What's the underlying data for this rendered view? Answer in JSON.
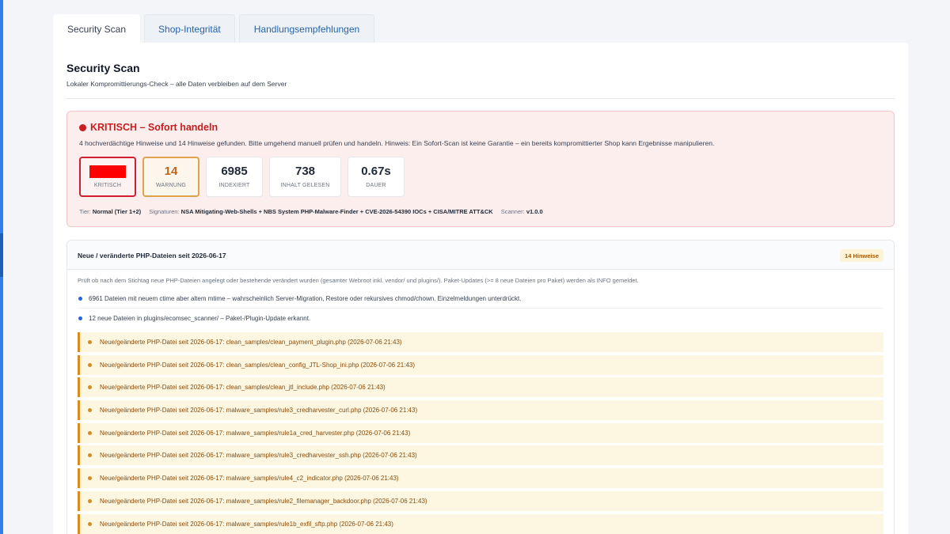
{
  "tabs": [
    {
      "label": "Security Scan",
      "active": true
    },
    {
      "label": "Shop-Integrität",
      "active": false
    },
    {
      "label": "Handlungsempfehlungen",
      "active": false
    }
  ],
  "page": {
    "title": "Security Scan",
    "subtitle": "Lokaler Kompromittierungs-Check – alle Daten verbleiben auf dem Server"
  },
  "alert": {
    "title": "KRITISCH – Sofort handeln",
    "text": "4 hochverdächtige Hinweise und 14 Hinweise gefunden. Bitte umgehend manuell prüfen und handeln. Hinweis: Ein Sofort-Scan ist keine Garantie – ein bereits kompromittierter Shop kann Ergebnisse manipulieren.",
    "color": "#c81e1e"
  },
  "stats": {
    "critical": {
      "value": "4",
      "label": "KRITISCH"
    },
    "warning": {
      "value": "14",
      "label": "WARNUNG"
    },
    "indexed": {
      "value": "6985",
      "label": "INDEXIERT"
    },
    "read": {
      "value": "738",
      "label": "INHALT GELESEN"
    },
    "duration": {
      "value": "0.67s",
      "label": "DAUER"
    }
  },
  "meta": {
    "tier_label": "Tier:",
    "tier_value": "Normal (Tier 1+2)",
    "signatures_label": "Signaturen:",
    "signatures_value": "NSA Mitigating-Web-Shells + NBS System PHP-Malware-Finder + CVE-2026-54390 IOCs + CISA/MITRE ATT&CK",
    "scanner_label": "Scanner:",
    "scanner_value": "v1.0.0"
  },
  "section": {
    "title": "Neue / veränderte PHP-Dateien seit 2026-06-17",
    "badge": "14 Hinweise",
    "description": "Prüft ob nach dem Stichtag neue PHP-Dateien angelegt oder bestehende verändert wurden (gesamter Webroot inkl. vendor/ und plugins/). Paket-Updates (>= 8 neue Dateien pro Paket) werden als INFO gemeldet.",
    "info": [
      "6961 Dateien mit neuem ctime aber altem mtime – wahrscheinlich Server-Migration, Restore oder rekursives chmod/chown. Einzelmeldungen unterdrückt.",
      "12 neue Dateien in plugins/ecomsec_scanner/ – Paket-/Plugin-Update erkannt."
    ],
    "warnings": [
      "Neue/geänderte PHP-Datei seit 2026-06-17: clean_samples/clean_payment_plugin.php (2026-07-06 21:43)",
      "Neue/geänderte PHP-Datei seit 2026-06-17: clean_samples/clean_config_JTL-Shop_ini.php (2026-07-06 21:43)",
      "Neue/geänderte PHP-Datei seit 2026-06-17: clean_samples/clean_jtl_include.php (2026-07-06 21:43)",
      "Neue/geänderte PHP-Datei seit 2026-06-17: malware_samples/rule3_credharvester_curl.php (2026-07-06 21:43)",
      "Neue/geänderte PHP-Datei seit 2026-06-17: malware_samples/rule1a_cred_harvester.php (2026-07-06 21:43)",
      "Neue/geänderte PHP-Datei seit 2026-06-17: malware_samples/rule3_credharvester_ssh.php (2026-07-06 21:43)",
      "Neue/geänderte PHP-Datei seit 2026-06-17: malware_samples/rule4_c2_indicator.php (2026-07-06 21:43)",
      "Neue/geänderte PHP-Datei seit 2026-06-17: malware_samples/rule2_filemanager_backdoor.php (2026-07-06 21:43)",
      "Neue/geänderte PHP-Datei seit 2026-06-17: malware_samples/rule1b_exfil_sftp.php (2026-07-06 21:43)"
    ]
  },
  "colors": {
    "critical": "#c81e1e",
    "warning": "#d98b1f",
    "info": "#2563eb",
    "accent": "#2f80ed"
  }
}
